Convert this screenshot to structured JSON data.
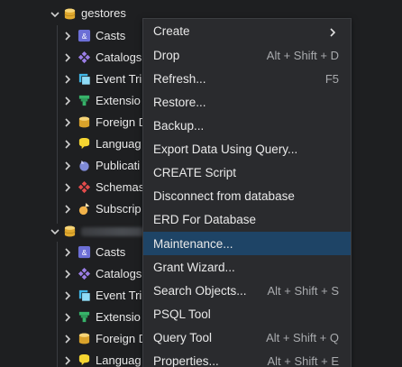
{
  "tree": {
    "database1": {
      "name": "gestores"
    },
    "database2": {
      "name": ""
    },
    "group1": [
      {
        "label": "Casts",
        "icon": "casts-icon"
      },
      {
        "label": "Catalogs",
        "icon": "catalogs-icon"
      },
      {
        "label": "Event Tri",
        "icon": "event-triggers-icon"
      },
      {
        "label": "Extensio",
        "icon": "extensions-icon"
      },
      {
        "label": "Foreign D",
        "icon": "foreign-data-wrappers-icon"
      },
      {
        "label": "Languag",
        "icon": "languages-icon"
      },
      {
        "label": "Publicati",
        "icon": "publications-icon"
      },
      {
        "label": "Schemas",
        "icon": "schemas-icon"
      },
      {
        "label": "Subscrip",
        "icon": "subscriptions-icon"
      }
    ],
    "group2": [
      {
        "label": "Casts",
        "icon": "casts-icon"
      },
      {
        "label": "Catalogs",
        "icon": "catalogs-icon"
      },
      {
        "label": "Event Tri",
        "icon": "event-triggers-icon"
      },
      {
        "label": "Extensio",
        "icon": "extensions-icon"
      },
      {
        "label": "Foreign D",
        "icon": "foreign-data-wrappers-icon"
      },
      {
        "label": "Languag",
        "icon": "languages-icon"
      }
    ]
  },
  "menu": {
    "items": [
      {
        "label": "Create",
        "shortcut": "",
        "submenu": true
      },
      {
        "label": "Drop",
        "shortcut": "Alt + Shift + D"
      },
      {
        "label": "Refresh...",
        "shortcut": "F5"
      },
      {
        "label": "Restore...",
        "shortcut": ""
      },
      {
        "label": "Backup...",
        "shortcut": ""
      },
      {
        "label": "Export Data Using Query...",
        "shortcut": ""
      },
      {
        "label": "CREATE Script",
        "shortcut": ""
      },
      {
        "label": "Disconnect from database",
        "shortcut": ""
      },
      {
        "label": "ERD For Database",
        "shortcut": ""
      },
      {
        "label": "Maintenance...",
        "shortcut": "",
        "highlighted": true
      },
      {
        "label": "Grant Wizard...",
        "shortcut": ""
      },
      {
        "label": "Search Objects...",
        "shortcut": "Alt + Shift + S"
      },
      {
        "label": "PSQL Tool",
        "shortcut": ""
      },
      {
        "label": "Query Tool",
        "shortcut": "Alt + Shift + Q"
      },
      {
        "label": "Properties...",
        "shortcut": "Alt + Shift + E"
      }
    ]
  },
  "colors": {
    "background": "#1e1f21",
    "menu_bg": "#2a2b2e",
    "highlight": "#1e4466",
    "text": "#e9e9e9",
    "shortcut_text": "#a9abae"
  }
}
